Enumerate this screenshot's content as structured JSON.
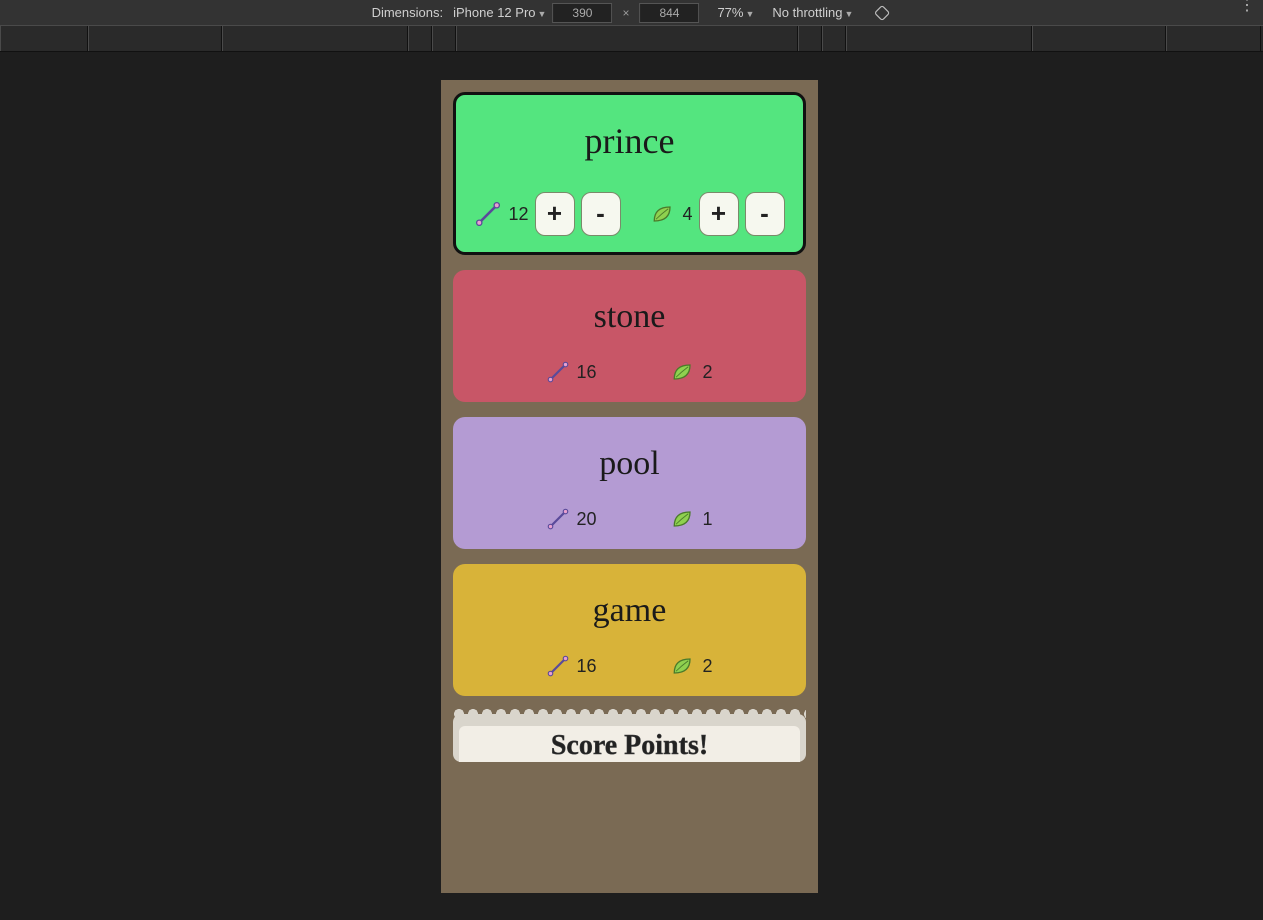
{
  "devtools": {
    "dimensions_label": "Dimensions:",
    "device_name": "iPhone 12 Pro",
    "width": "390",
    "height": "844",
    "zoom": "77%",
    "throttling": "No throttling"
  },
  "cards": [
    {
      "name": "prince",
      "color": "#54e57f",
      "selected": true,
      "sticks": 12,
      "leaves": 4
    },
    {
      "name": "stone",
      "color": "#c85667",
      "selected": false,
      "sticks": 16,
      "leaves": 2
    },
    {
      "name": "pool",
      "color": "#b49bd3",
      "selected": false,
      "sticks": 20,
      "leaves": 1
    },
    {
      "name": "game",
      "color": "#d8b339",
      "selected": false,
      "sticks": 16,
      "leaves": 2
    }
  ],
  "buttons": {
    "plus": "+",
    "minus": "-"
  },
  "score_panel": {
    "title": "Score Points!"
  }
}
